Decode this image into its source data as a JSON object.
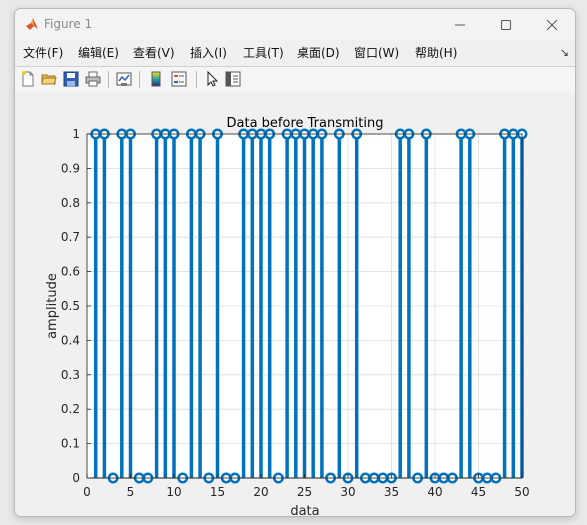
{
  "window": {
    "title": "Figure 1",
    "minimize_icon": "minimize-icon",
    "maximize_icon": "maximize-icon",
    "close_icon": "close-icon"
  },
  "menu": [
    {
      "label": "文件(F)"
    },
    {
      "label": "编辑(E)"
    },
    {
      "label": "查看(V)"
    },
    {
      "label": "插入(I)"
    },
    {
      "label": "工具(T)"
    },
    {
      "label": "桌面(D)"
    },
    {
      "label": "窗口(W)"
    },
    {
      "label": "帮助(H)"
    }
  ],
  "toolbar": {
    "icons": [
      "new-figure-icon",
      "open-file-icon",
      "save-icon",
      "print-icon",
      "link-plot-icon",
      "colorbar-icon",
      "legend-icon",
      "pointer-icon",
      "property-inspector-icon"
    ]
  },
  "colors": {
    "stem": "#0072bd",
    "grid": "#dcdcdc",
    "axis": "#262626"
  },
  "chart_data": {
    "type": "stem",
    "title": "Data before Transmiting",
    "xlabel": "data",
    "ylabel": "amplitude",
    "xlim": [
      0,
      50
    ],
    "ylim": [
      0,
      1
    ],
    "xticks": [
      "0",
      "5",
      "10",
      "15",
      "20",
      "25",
      "30",
      "35",
      "40",
      "45",
      "50"
    ],
    "yticks": [
      "0",
      "0.1",
      "0.2",
      "0.3",
      "0.4",
      "0.5",
      "0.6",
      "0.7",
      "0.8",
      "0.9",
      "1"
    ],
    "grid": true,
    "x": [
      1,
      2,
      3,
      4,
      5,
      6,
      7,
      8,
      9,
      10,
      11,
      12,
      13,
      14,
      15,
      16,
      17,
      18,
      19,
      20,
      21,
      22,
      23,
      24,
      25,
      26,
      27,
      28,
      29,
      30,
      31,
      32,
      33,
      34,
      35,
      36,
      37,
      38,
      39,
      40,
      41,
      42,
      43,
      44,
      45,
      46,
      47,
      48,
      49,
      50
    ],
    "y": [
      1,
      1,
      0,
      1,
      1,
      0,
      0,
      1,
      1,
      1,
      0,
      1,
      1,
      0,
      1,
      0,
      0,
      1,
      1,
      1,
      1,
      0,
      1,
      1,
      1,
      1,
      1,
      0,
      1,
      0,
      1,
      0,
      0,
      0,
      0,
      1,
      1,
      0,
      1,
      0,
      0,
      0,
      1,
      1,
      0,
      0,
      0,
      1,
      1,
      1
    ]
  }
}
